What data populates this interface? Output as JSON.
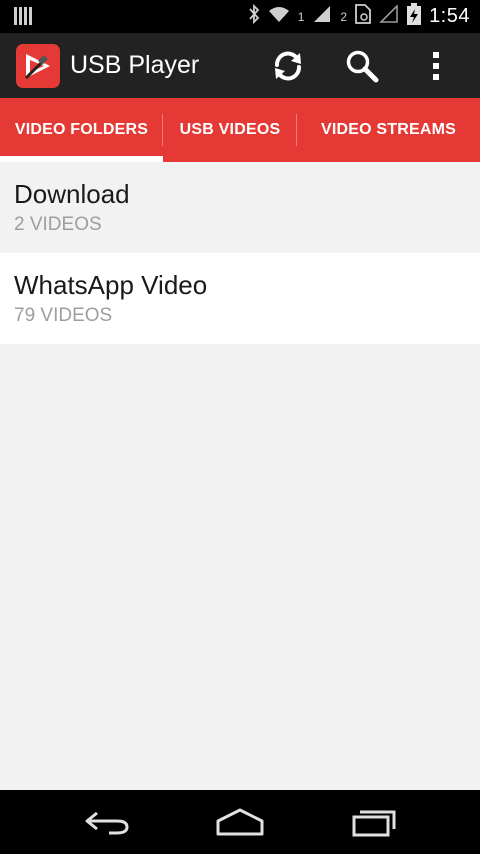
{
  "status_bar": {
    "sim1_label": "1",
    "sim2_label": "2",
    "time": "1:54"
  },
  "app_bar": {
    "title": "USB Player",
    "icons": [
      "refresh-icon",
      "search-icon",
      "overflow-menu-icon"
    ]
  },
  "tabs": [
    {
      "label": "VIDEO FOLDERS",
      "selected": true
    },
    {
      "label": "USB VIDEOS",
      "selected": false
    },
    {
      "label": "VIDEO STREAMS",
      "selected": false
    }
  ],
  "folders": [
    {
      "name": "Download",
      "count": "2 VIDEOS"
    },
    {
      "name": "WhatsApp Video",
      "count": "79 VIDEOS"
    }
  ],
  "nav_bar": {
    "icons": [
      "back-icon",
      "home-icon",
      "recents-icon"
    ]
  },
  "colors": {
    "accent": "#e53935",
    "action_bar": "#222222",
    "background": "#f2f2f2"
  }
}
